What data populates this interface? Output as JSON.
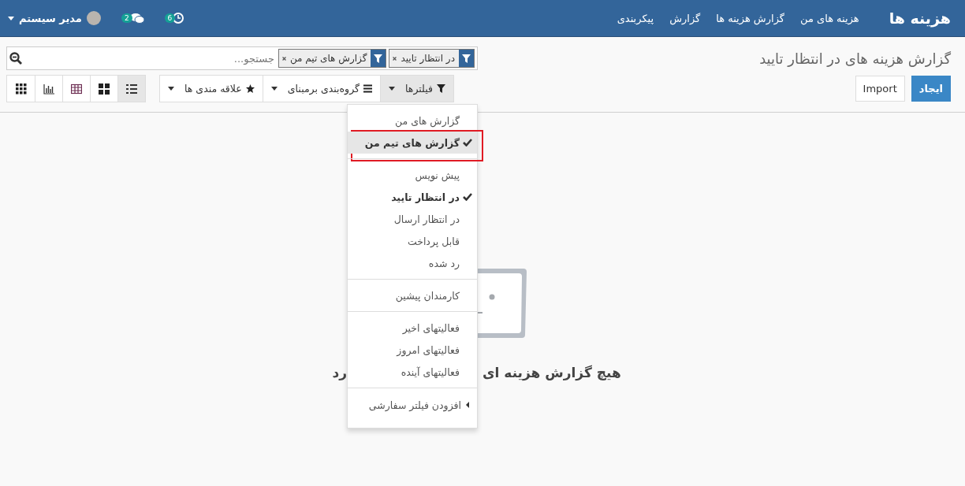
{
  "navbar": {
    "brand": "هزینه ها",
    "menu": [
      "هزینه های من",
      "گزارش هزینه ها",
      "گزارش",
      "پیکربندی"
    ],
    "systray": {
      "activities_count": "6",
      "messages_count": "2",
      "user": "مدیر سیستم"
    }
  },
  "control_panel": {
    "title": "گزارش هزینه های در انتظار تایید",
    "buttons": [
      {
        "label": "ایجاد",
        "kind": "primary"
      },
      {
        "label": "Import",
        "kind": "default"
      }
    ],
    "search": {
      "facets": [
        {
          "label": "در انتظار تایید"
        },
        {
          "label": "گزارش های تیم من"
        }
      ],
      "placeholder": "جستجو..."
    },
    "dropdowns": [
      {
        "label": "فیلترها",
        "open": true
      },
      {
        "label": "گروه‌بندی برمبنای",
        "open": false
      },
      {
        "label": "علاقه مندی ها",
        "open": false
      }
    ],
    "views": [
      {
        "kind": "list",
        "selected": true
      },
      {
        "kind": "kanban",
        "selected": false
      },
      {
        "kind": "pivot",
        "selected": false
      },
      {
        "kind": "graph",
        "selected": false
      },
      {
        "kind": "dashboard",
        "selected": false
      }
    ]
  },
  "filter_menu": {
    "groups": [
      [
        {
          "label": "گزارش های من",
          "checked": false,
          "highlighted": false
        },
        {
          "label": "گزارش های تیم من",
          "checked": true,
          "highlighted": true
        }
      ],
      [
        {
          "label": "پیش نویس",
          "checked": false,
          "highlighted": false
        },
        {
          "label": "در انتظار تایید",
          "checked": true,
          "highlighted": false
        },
        {
          "label": "در انتظار ارسال",
          "checked": false,
          "highlighted": false
        },
        {
          "label": "قابل پرداخت",
          "checked": false,
          "highlighted": false
        },
        {
          "label": "رد شده",
          "checked": false,
          "highlighted": false
        }
      ],
      [
        {
          "label": "کارمندان پیشین",
          "checked": false,
          "highlighted": false
        }
      ],
      [
        {
          "label": "فعالیتهای اخیر",
          "checked": false,
          "highlighted": false
        },
        {
          "label": "فعالیتهای امروز",
          "checked": false,
          "highlighted": false
        },
        {
          "label": "فعالیتهای آینده",
          "checked": false,
          "highlighted": false
        }
      ]
    ],
    "custom_filter": "افزودن فیلتر سفارشی"
  },
  "empty_state": {
    "text_parts": [
      "هیچ گزارش هزینه ای",
      "رد"
    ]
  }
}
